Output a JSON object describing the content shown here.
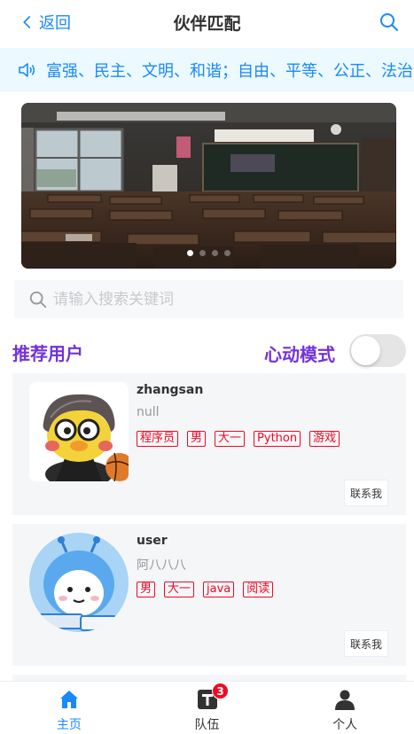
{
  "navbar": {
    "back_label": "返回",
    "title": "伙伴匹配"
  },
  "notice": {
    "text": "富强、民主、文明、和谐；自由、平等、公正、法治"
  },
  "swipe": {
    "slides": 4,
    "active_index": 0,
    "image_label": "classroom"
  },
  "search": {
    "placeholder": "请输入搜索关键词",
    "value": ""
  },
  "section": {
    "title": "推荐用户",
    "heart_mode_label": "心动模式",
    "heart_mode_on": false
  },
  "users": [
    {
      "name": "zhangsan",
      "profile": "null",
      "tags": [
        "程序员",
        "男",
        "大一",
        "Python",
        "游戏"
      ],
      "contact_label": "联系我",
      "avatar": "duck-avatar-icon"
    },
    {
      "name": "user",
      "profile": "阿八八八",
      "tags": [
        "男",
        "大一",
        "java",
        "阅读"
      ],
      "contact_label": "联系我",
      "avatar": "blue-character-avatar-icon"
    }
  ],
  "tabbar": {
    "items": [
      {
        "label": "主页",
        "icon": "home-icon",
        "active": true
      },
      {
        "label": "队伍",
        "icon": "team-icon",
        "badge": "3"
      },
      {
        "label": "个人",
        "icon": "user-icon"
      }
    ]
  },
  "colors": {
    "accent": "#1989fa",
    "purple": "#7232dd",
    "tag_red": "#ee0a24",
    "notice_bg": "#ecf9ff",
    "card_bg": "#f5f6f8"
  }
}
